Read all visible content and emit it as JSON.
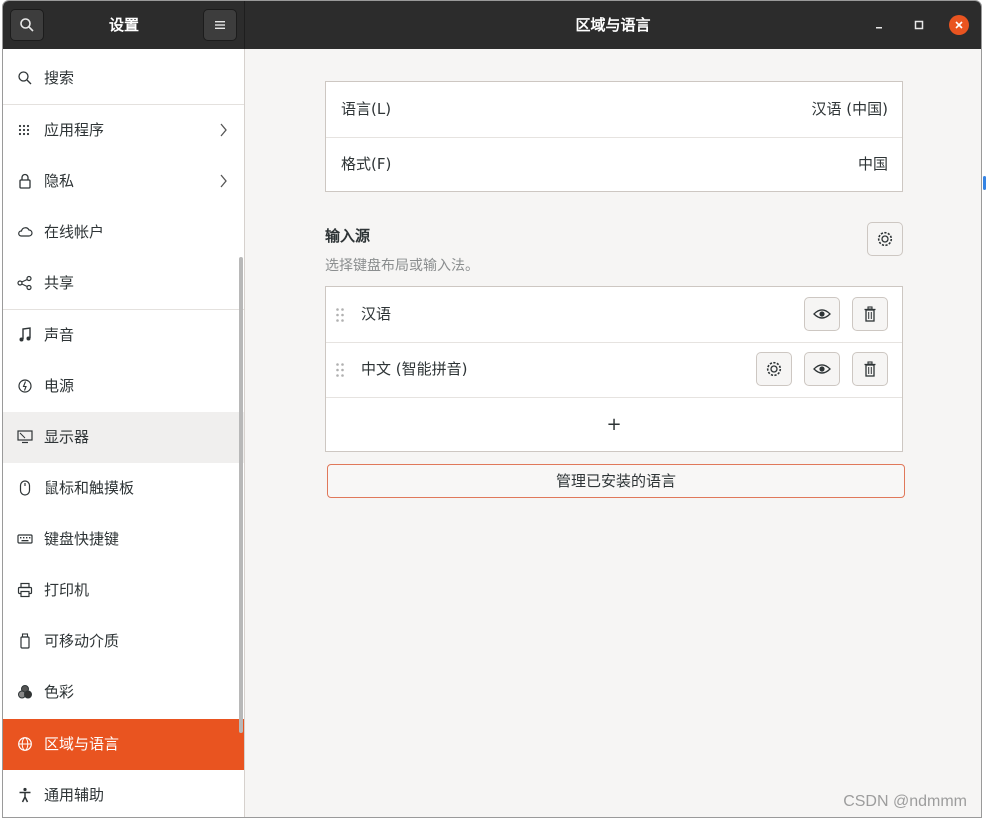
{
  "header": {
    "left_title": "设置",
    "main_title": "区域与语言"
  },
  "sidebar": {
    "items": [
      {
        "label": "搜索",
        "icon": "search-icon"
      },
      {
        "label": "应用程序",
        "icon": "grid-icon"
      },
      {
        "label": "隐私",
        "icon": "lock-icon"
      },
      {
        "label": "在线帐户",
        "icon": "cloud-icon"
      },
      {
        "label": "共享",
        "icon": "share-icon"
      },
      {
        "label": "声音",
        "icon": "music-note-icon"
      },
      {
        "label": "电源",
        "icon": "power-icon"
      },
      {
        "label": "显示器",
        "icon": "display-icon"
      },
      {
        "label": "鼠标和触摸板",
        "icon": "mouse-icon"
      },
      {
        "label": "键盘快捷键",
        "icon": "keyboard-icon"
      },
      {
        "label": "打印机",
        "icon": "printer-icon"
      },
      {
        "label": "可移动介质",
        "icon": "removable-media-icon"
      },
      {
        "label": "色彩",
        "icon": "color-icon"
      },
      {
        "label": "区域与语言",
        "icon": "globe-icon"
      },
      {
        "label": "通用辅助",
        "icon": "accessibility-icon"
      }
    ]
  },
  "main": {
    "language_label": "语言(L)",
    "language_value": "汉语 (中国)",
    "format_label": "格式(F)",
    "format_value": "中国",
    "input_sources_title": "输入源",
    "input_sources_subtitle": "选择键盘布局或输入法。",
    "input_sources": [
      {
        "label": "汉语"
      },
      {
        "label": "中文 (智能拼音)"
      }
    ],
    "add_label": "+",
    "manage_button": "管理已安装的语言"
  },
  "watermark": "CSDN @ndmmm",
  "colors": {
    "accent": "#e95420",
    "headerbar": "#2c2c2c",
    "background": "#f6f5f4"
  }
}
